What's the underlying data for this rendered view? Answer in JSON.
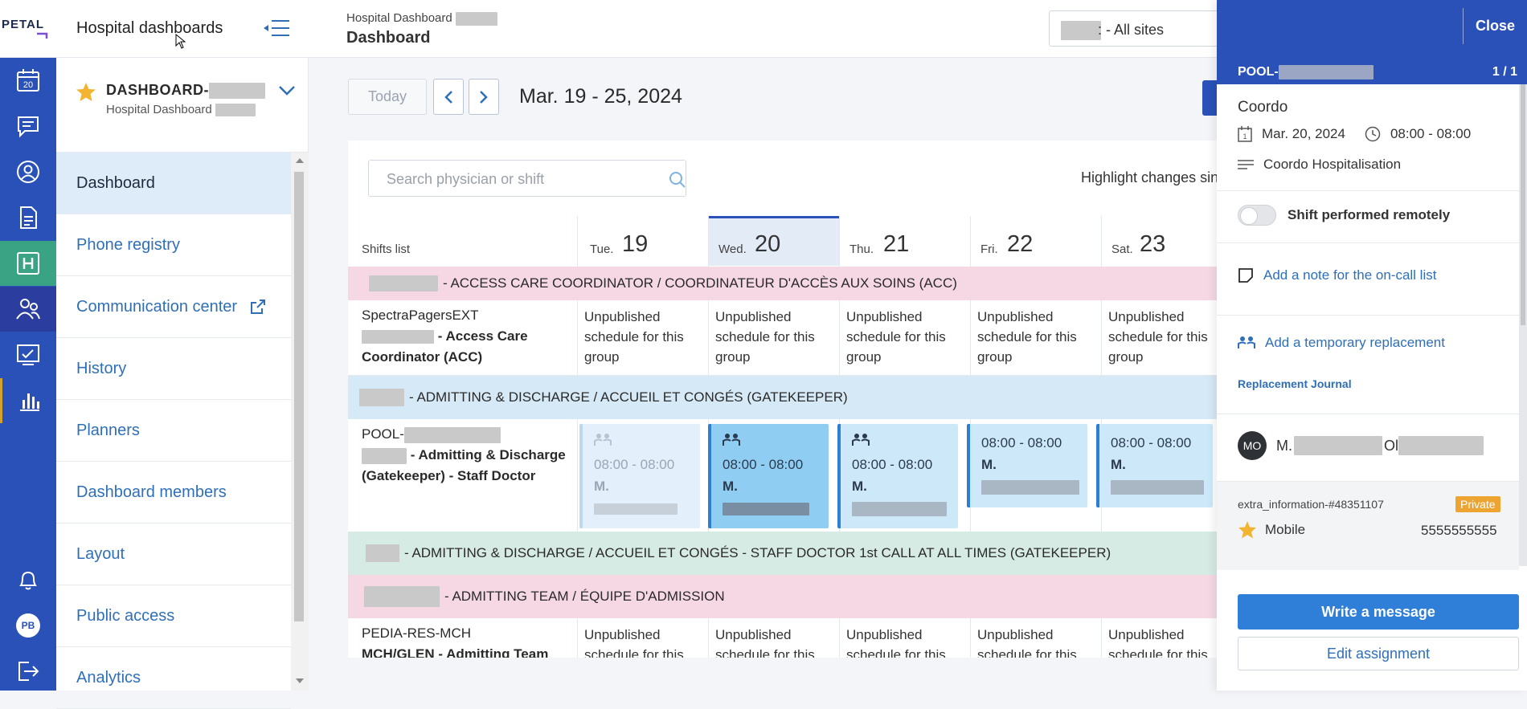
{
  "topbar": {
    "logo_text": "PETAL",
    "app_title": "Hospital dashboards",
    "breadcrumb": "Hospital Dashboard",
    "page_title": "Dashboard",
    "site_select": ": - All sites"
  },
  "rail": {
    "calendar_day": "20",
    "avatar_initials": "PB"
  },
  "nav": {
    "dashboard_name": "DASHBOARD-",
    "dashboard_sub": "Hospital Dashboard",
    "items": [
      {
        "label": "Dashboard",
        "active": true
      },
      {
        "label": "Phone registry"
      },
      {
        "label": "Communication center",
        "external": true
      },
      {
        "label": "History"
      },
      {
        "label": "Planners"
      },
      {
        "label": "Dashboard members"
      },
      {
        "label": "Layout"
      },
      {
        "label": "Public access"
      },
      {
        "label": "Analytics"
      }
    ]
  },
  "calendar": {
    "today_label": "Today",
    "range": "Mar. 19 - 25, 2024",
    "search_placeholder": "Search physician or shift",
    "highlight_label": "Highlight changes since",
    "shifts_list_label": "Shifts list",
    "days": [
      {
        "dow": "Tue.",
        "day": "19"
      },
      {
        "dow": "Wed.",
        "day": "20",
        "selected": true
      },
      {
        "dow": "Thu.",
        "day": "21"
      },
      {
        "dow": "Fri.",
        "day": "22"
      },
      {
        "dow": "Sat.",
        "day": "23"
      }
    ],
    "groups": {
      "acc": "- ACCESS CARE COORDINATOR / COORDINATEUR D'ACCÈS AUX SOINS (ACC)",
      "admitting": "- ADMITTING & DISCHARGE / ACCUEIL ET CONGÉS (GATEKEEPER)",
      "staff_first_call": "- ADMITTING & DISCHARGE / ACCUEIL ET CONGÉS - STAFF DOCTOR 1st CALL AT ALL TIMES (GATEKEEPER)",
      "admitting_team": "- ADMITTING TEAM / ÉQUIPE D'ADMISSION"
    },
    "rows": {
      "acc": {
        "line1": "SpectraPagersEXT",
        "line2": "- Access Care",
        "line3": "Coordinator (ACC)"
      },
      "gatekeeper": {
        "line1": "POOL-",
        "line2": "- Admitting & Discharge",
        "line3": "(Gatekeeper) - Staff Doctor"
      },
      "pedia": {
        "line1": "PEDIA-RES-MCH",
        "line2": "MCH/GLEN - Admitting Team"
      }
    },
    "unpublished_text": "Unpublished schedule for this group",
    "shift_time": "08:00 - 08:00",
    "shift_name": "M."
  },
  "panel": {
    "close_label": "Close",
    "pool_label": "POOL-",
    "count": "1 / 1",
    "shift_title": "Coordo",
    "date": "Mar. 20, 2024",
    "time": "08:00 - 08:00",
    "description": "Coordo Hospitalisation",
    "remote_label": "Shift performed remotely",
    "add_note": "Add a note for the on-call list",
    "add_replacement": "Add a temporary replacement",
    "journal": "Replacement Journal",
    "member_initials": "MO",
    "member_first": "M.",
    "member_last": "Ol",
    "extra_info": "extra_information-#48351107",
    "private_label": "Private",
    "phone_type": "Mobile",
    "phone_number": "5555555555",
    "write_message": "Write a message",
    "edit_assignment": "Edit assignment"
  },
  "colors": {
    "brand_blue": "#2951b8",
    "active_green": "#3aa383",
    "link_blue": "#2f6fb8",
    "private_orange": "#eea430"
  }
}
